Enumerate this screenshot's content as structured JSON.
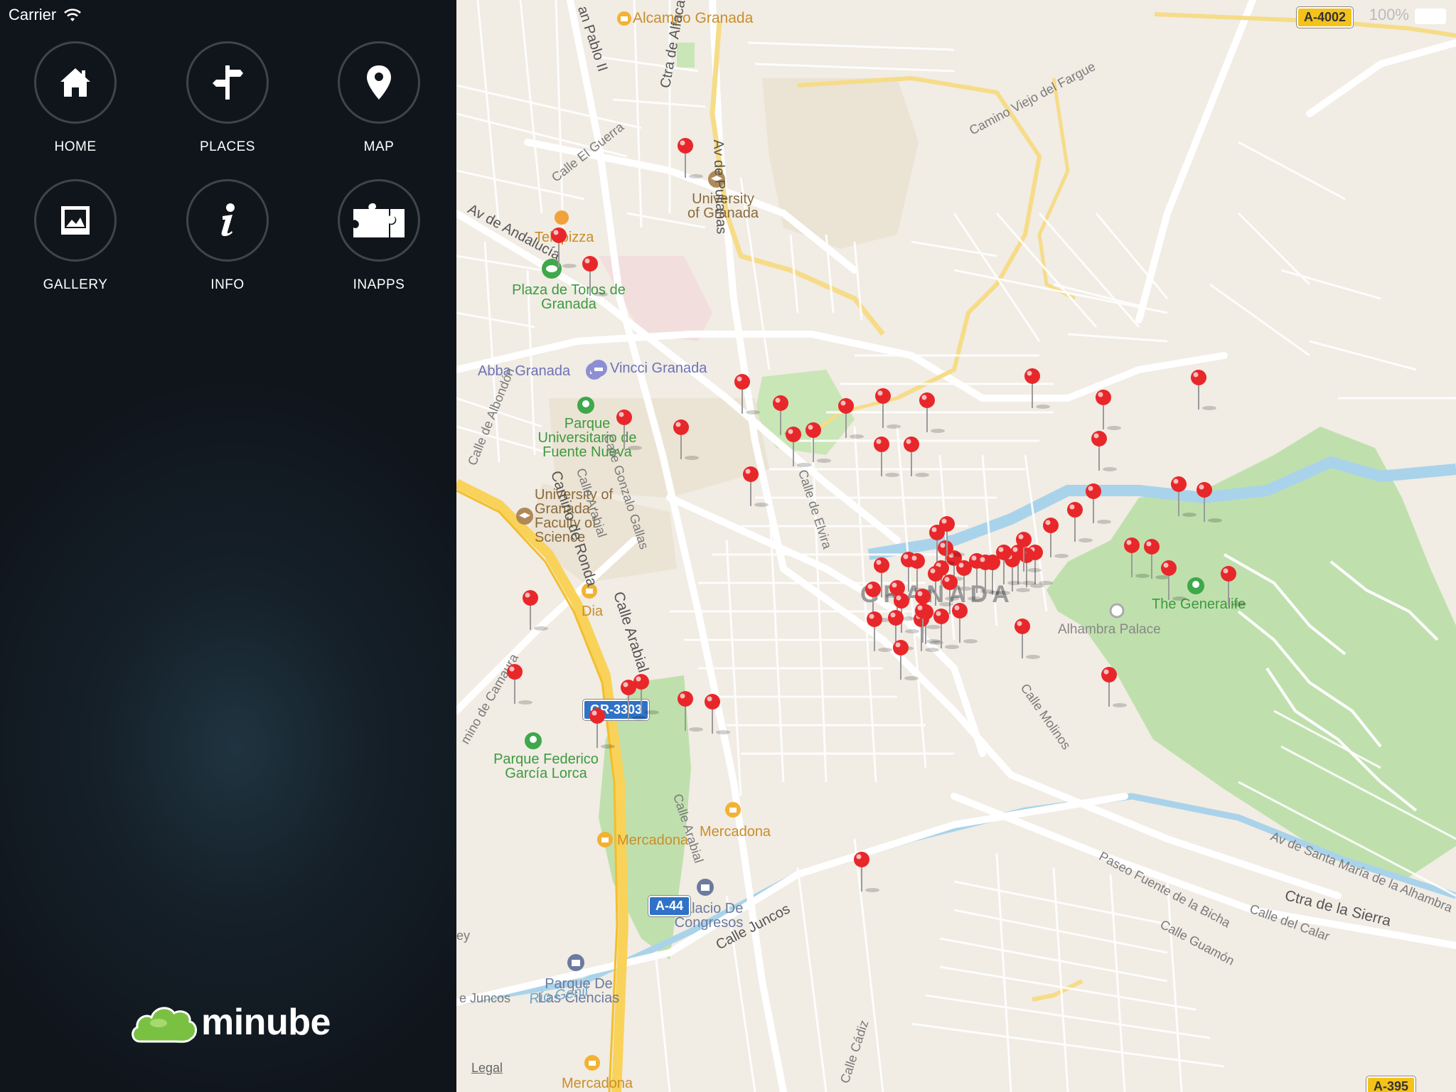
{
  "status": {
    "carrier": "Carrier",
    "battery": "100%"
  },
  "menu": [
    {
      "id": "home",
      "label": "HOME",
      "icon": "home-icon"
    },
    {
      "id": "places",
      "label": "PLACES",
      "icon": "signpost-icon"
    },
    {
      "id": "map",
      "label": "MAP",
      "icon": "map-pin-icon"
    },
    {
      "id": "gallery",
      "label": "GALLERY",
      "icon": "gallery-icon"
    },
    {
      "id": "info",
      "label": "INFO",
      "icon": "info-icon"
    },
    {
      "id": "inapps",
      "label": "INAPPS",
      "icon": "puzzle-icon"
    }
  ],
  "brand": {
    "name": "minube",
    "logo_color": "#7ac143"
  },
  "map": {
    "legal": "Legal",
    "labels": {
      "alcampo": "Alcampo Granada",
      "telepizza": "Telepizza",
      "plaza_toros": "Plaza de Toros de Granada",
      "abba": "Abba Granada",
      "vincci": "Vincci Granada",
      "university": "University of Granada",
      "parque_uni": "Parque Universitario de Fuente Nueva",
      "faculty": "University of Granada - Faculty of Science",
      "dia": "Dia",
      "granada": "GRANADA",
      "generalife": "The Generalife",
      "alhambra": "Alhambra Palace",
      "parque_lorca": "Parque Federico García Lorca",
      "mercadona_1": "Mercadona",
      "mercadona_2": "Mercadona",
      "mercadona_3": "Mercadona",
      "palacio": "Palacio De Congresos",
      "parque_ciencias": "Parque De Las Ciencias",
      "rio_genil": "Río Genil",
      "juncos": "Calle Juncos",
      "juncos2": "e Juncos",
      "camino_ronda": "Camino de Ronda",
      "calle_arabial": "Calle Arabial",
      "calle_arabial2": "Calle Arabial",
      "calle_arabial3": "Calle Arabial",
      "av_andalucia": "Av de Andalucía",
      "av_pulianas": "Av de Pulianas",
      "calle_guerra": "Calle El Guerra",
      "ctra_alfacar": "Ctra de Alfacar",
      "pablo": "an Pablo II",
      "camino_fargue": "Camino Viejo del Fargue",
      "calle_albondon": "Calle de Albondón",
      "calle_gallas": "Calle Gonzalo Gallas",
      "camino_camaura": "mino de Camaura",
      "calle_elvira": "Calle de Elvira",
      "calle_molinos": "Calle Molinos",
      "paseo_bicha": "Paseo Fuente de la Bicha",
      "calle_guamon": "Calle Guamón",
      "calle_calar": "Calle del Calar",
      "ctra_sierra": "Ctra de la Sierra",
      "av_santa_maria": "Av de Santa María de la Alhambra",
      "calle_cadiz": "Calle Cádiz",
      "ey": "ey"
    },
    "shields": {
      "gr3303": "GR-3303",
      "a44": "A-44",
      "a4002": "A-4002",
      "a395": "A-395"
    },
    "pin_color": "#e8272a",
    "pin_count": 60
  }
}
